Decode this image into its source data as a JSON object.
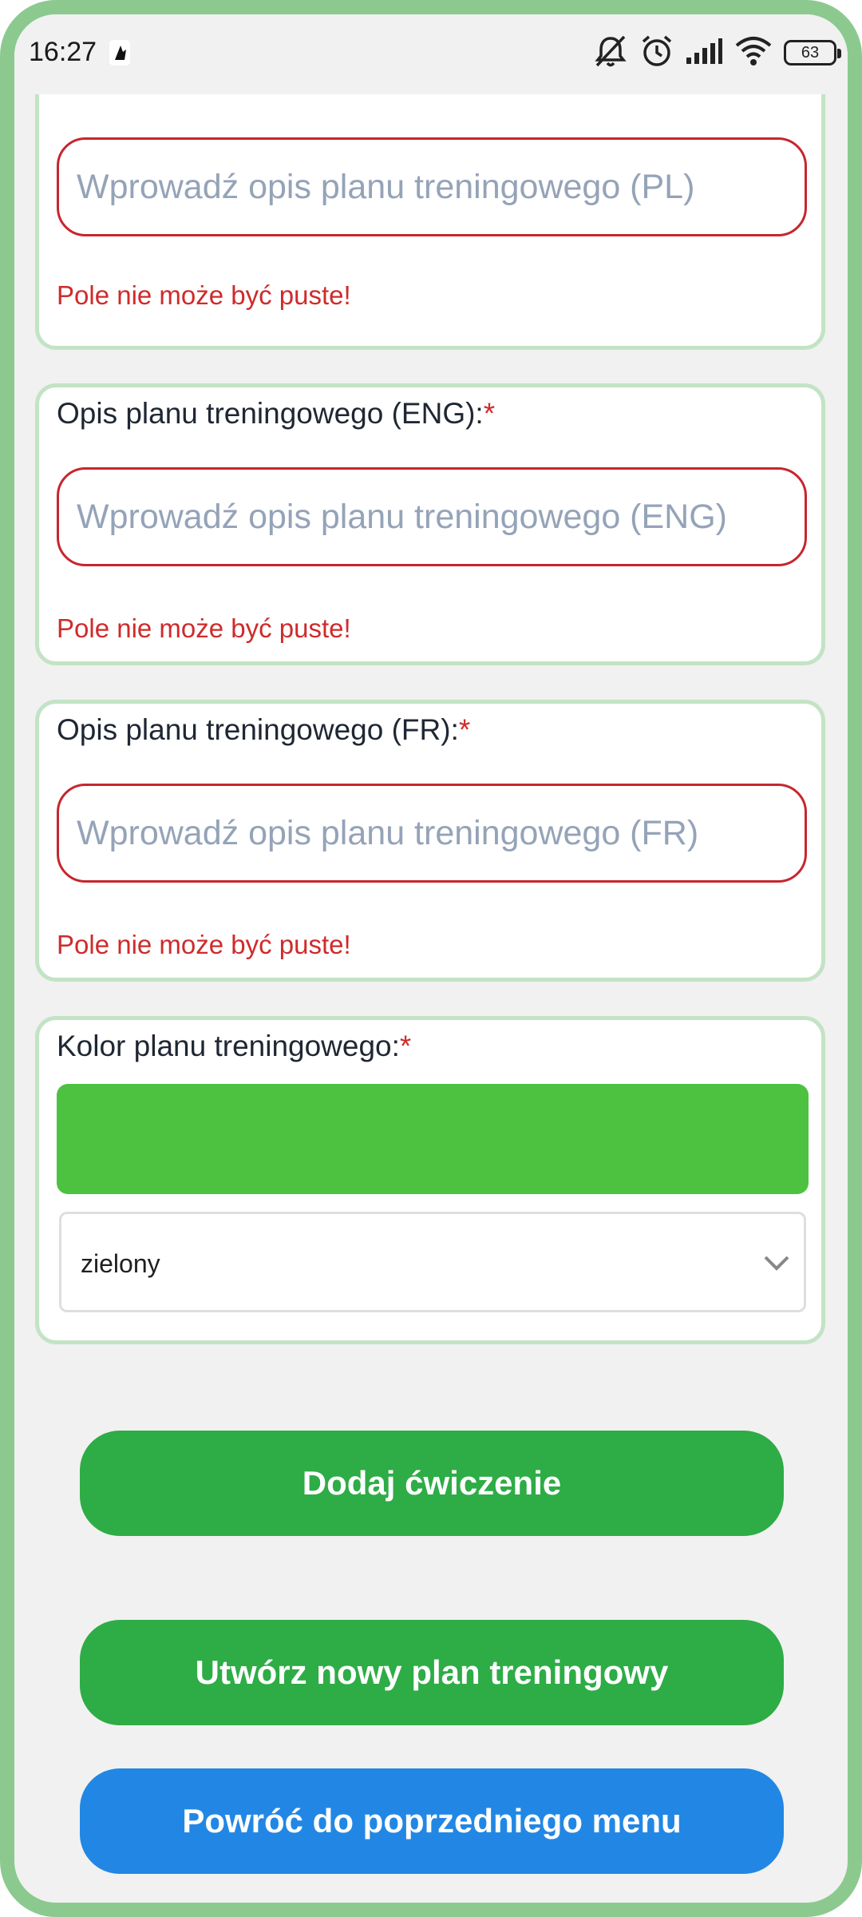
{
  "status_bar": {
    "time": "16:27",
    "battery": "63",
    "icons": [
      "notification-icon",
      "muted-bell-icon",
      "alarm-icon",
      "signal-icon",
      "wifi-icon",
      "battery-icon"
    ]
  },
  "form": {
    "desc_pl": {
      "placeholder": "Wprowadź opis planu treningowego (PL)",
      "error": "Pole nie może być puste!"
    },
    "desc_eng": {
      "label": "Opis planu treningowego (ENG):",
      "required_mark": "*",
      "placeholder": "Wprowadź opis planu treningowego (ENG)",
      "error": "Pole nie może być puste!"
    },
    "desc_fr": {
      "label": "Opis planu treningowego (FR):",
      "required_mark": "*",
      "placeholder": "Wprowadź opis planu treningowego (FR)",
      "error": "Pole nie może być puste!"
    },
    "color": {
      "label": "Kolor planu treningowego:",
      "required_mark": "*",
      "swatch_color": "#4cc240",
      "selected": "zielony"
    }
  },
  "buttons": {
    "add_exercise": "Dodaj ćwiczenie",
    "create_plan": "Utwórz nowy plan treningowy",
    "back": "Powróć do poprzedniego menu"
  },
  "colors": {
    "accent_green": "#2eac46",
    "accent_blue": "#2287e4",
    "error_red": "#cf2b2b",
    "frame_green": "#8cc98f"
  }
}
